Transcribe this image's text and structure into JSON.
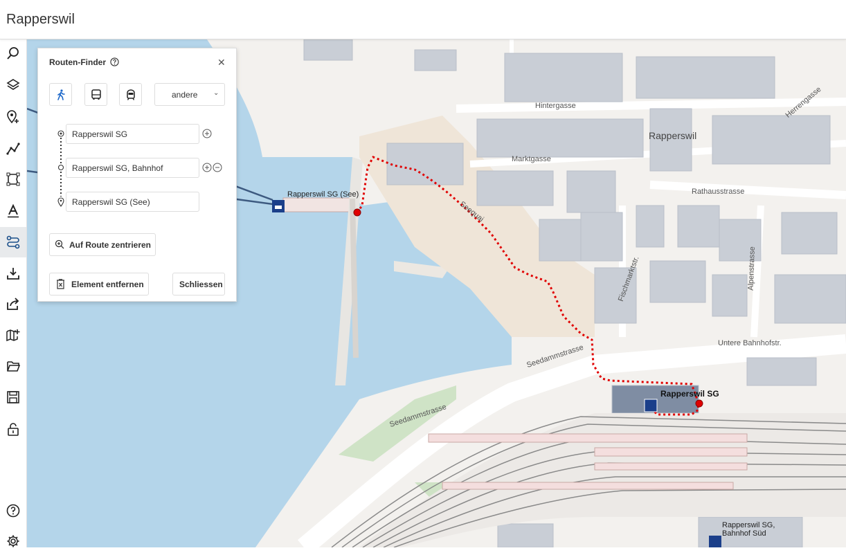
{
  "app": {
    "title": "Rapperswil"
  },
  "sidebar": {
    "items": [
      {
        "icon": "search-icon"
      },
      {
        "icon": "layers-icon"
      },
      {
        "icon": "add-marker-icon"
      },
      {
        "icon": "line-icon"
      },
      {
        "icon": "polygon-icon"
      },
      {
        "icon": "text-icon"
      },
      {
        "icon": "route-icon",
        "active": true
      },
      {
        "icon": "download-icon"
      },
      {
        "icon": "share-icon"
      },
      {
        "icon": "add-map-icon"
      },
      {
        "icon": "folder-open-icon"
      },
      {
        "icon": "save-icon"
      },
      {
        "icon": "lock-icon"
      }
    ],
    "bottom": [
      {
        "icon": "help-icon"
      },
      {
        "icon": "settings-icon"
      }
    ]
  },
  "route_finder": {
    "title": "Routen-Finder",
    "modes": [
      "walk-icon",
      "bus-icon",
      "train-icon"
    ],
    "other_mode": "andere",
    "stops": [
      {
        "value": "Rapperswil SG"
      },
      {
        "value": "Rapperswil SG, Bahnhof"
      },
      {
        "value": "Rapperswil SG (See)"
      }
    ],
    "center_label": "Auf Route zentrieren",
    "remove_label": "Element entfernen",
    "close_label": "Schliessen"
  },
  "map": {
    "streets": [
      "Hintergasse",
      "Marktgasse",
      "Rathausstrasse",
      "Herrengasse",
      "Fischmarktstr.",
      "Alpenstrasse",
      "Untere Bahnhofstr.",
      "Seedammstrasse",
      "Seedammstrasse",
      "Seequai"
    ],
    "place": "Rapperswil",
    "stations": [
      "Rapperswil SG (See)",
      "Rapperswil SG",
      "Rapperswil SG,\nBahnhof Süd"
    ],
    "route_color": "#e00000",
    "water_color": "#b4d5ea"
  }
}
